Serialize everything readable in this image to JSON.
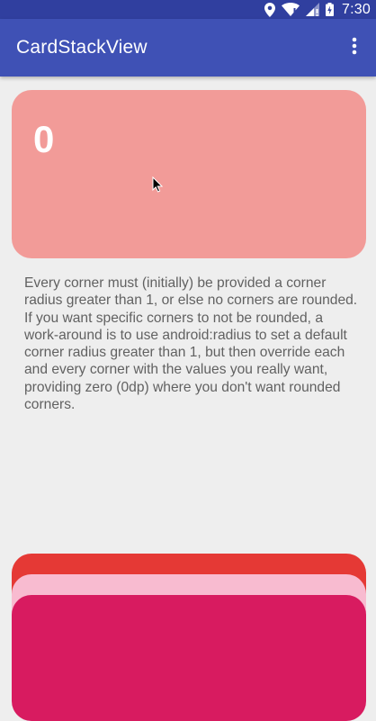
{
  "status_bar": {
    "time": "7:30",
    "icons": [
      "location-icon",
      "wifi-icon",
      "signal-icon",
      "battery-icon"
    ]
  },
  "app_bar": {
    "title": "CardStackView",
    "overflow_icon": "more-vert-icon"
  },
  "top_card": {
    "label": "0",
    "color": "#f29b98"
  },
  "description": "Every corner must (initially) be provided a corner radius greater than 1, or else no corners are rounded. If you want specific corners to not be rounded, a work-around is to use android:radius to set a default corner radius greater than 1, but then override each and every corner with the values you really want, providing zero (0dp) where you don't want rounded corners.",
  "stack_cards": [
    {
      "color": "#e53935"
    },
    {
      "color": "#f8bbd0"
    },
    {
      "color": "#d81b60"
    }
  ],
  "colors": {
    "status_bar": "#303f9f",
    "app_bar": "#3f51b5",
    "background": "#eeeeee"
  }
}
